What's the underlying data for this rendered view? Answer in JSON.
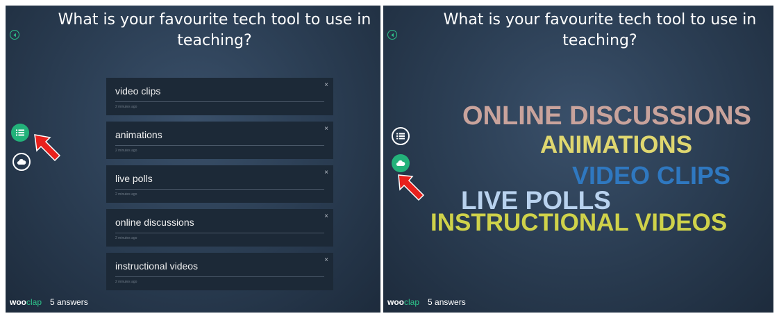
{
  "question": "What is your favourite tech tool to use in teaching?",
  "answers": [
    {
      "text": "video clips",
      "time": "2 minutes ago"
    },
    {
      "text": "animations",
      "time": "2 minutes ago"
    },
    {
      "text": "live polls",
      "time": "2 minutes ago"
    },
    {
      "text": "online discussions",
      "time": "2 minutes ago"
    },
    {
      "text": "instructional videos",
      "time": "2 minutes ago"
    }
  ],
  "close_glyph": "×",
  "word_cloud": [
    {
      "text": "ONLINE DISCUSSIONS",
      "color": "#c9a39c"
    },
    {
      "text": "ANIMATIONS",
      "color": "#dfd770"
    },
    {
      "text": "VIDEO CLIPS",
      "color": "#2f78c0"
    },
    {
      "text": "LIVE POLLS",
      "color": "#b9d2ee"
    },
    {
      "text": "INSTRUCTIONAL VIDEOS",
      "color": "#cfd24a"
    }
  ],
  "footer": {
    "logo_part1": "woo",
    "logo_part2": "clap",
    "answers_count": "5 answers"
  },
  "icons": {
    "back": "chevron-left-icon",
    "list_view": "list-icon",
    "cloud_view": "cloud-icon",
    "pointer": "red-arrow-icon"
  },
  "colors": {
    "accent": "#23b27a",
    "background": "#2c3f55",
    "card": "#1c2937",
    "arrow": "#e8201c"
  }
}
